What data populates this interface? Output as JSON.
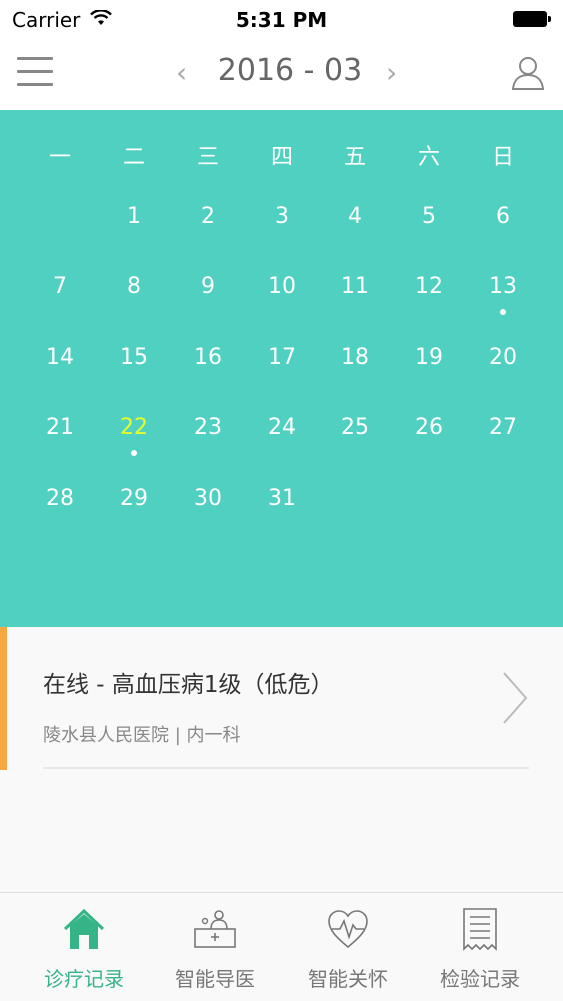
{
  "status_bar": {
    "carrier": "Carrier",
    "time": "5:31 PM"
  },
  "nav": {
    "title": "2016 - 03",
    "prev": "‹",
    "next": "›",
    "menu_icon": "hamburger-menu-icon",
    "user_icon": "user-profile-icon"
  },
  "calendar": {
    "weekdays": [
      "一",
      "二",
      "三",
      "四",
      "五",
      "六",
      "日"
    ],
    "rows": [
      [
        "",
        "1",
        "2",
        "3",
        "4",
        "5",
        "6"
      ],
      [
        "7",
        "8",
        "9",
        "10",
        "11",
        "12",
        "13"
      ],
      [
        "14",
        "15",
        "16",
        "17",
        "18",
        "19",
        "20"
      ],
      [
        "21",
        "22",
        "23",
        "24",
        "25",
        "26",
        "27"
      ],
      [
        "28",
        "29",
        "30",
        "31",
        "",
        "",
        ""
      ]
    ],
    "selected_day": "22",
    "marked_days": [
      "13",
      "22"
    ],
    "colors": {
      "background": "#50d0c0",
      "selected": "#e6ff2a"
    }
  },
  "record": {
    "title": "在线 - 高血压病1级（低危）",
    "subtitle": "陵水县人民医院 | 内一科",
    "accent_color": "#f5a742"
  },
  "tabs": [
    {
      "label": "诊疗记录",
      "icon": "home-icon",
      "active": true
    },
    {
      "label": "智能导医",
      "icon": "doctor-desk-icon",
      "active": false
    },
    {
      "label": "智能关怀",
      "icon": "heart-pulse-icon",
      "active": false
    },
    {
      "label": "检验记录",
      "icon": "lab-report-icon",
      "active": false
    }
  ]
}
